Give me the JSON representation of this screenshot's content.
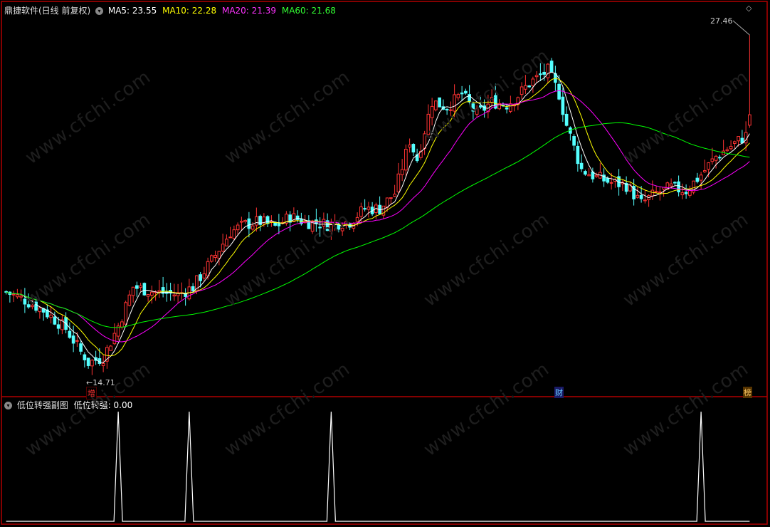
{
  "header": {
    "title": "鼎捷软件(日线 前复权)",
    "ma5_label": "MA5: 23.55",
    "ma10_label": "MA10: 22.28",
    "ma20_label": "MA20: 21.39",
    "ma60_label": "MA60: 21.68"
  },
  "sub_header": {
    "title": "低位转强副图",
    "value_label": "低位转强: 0.00"
  },
  "markers": {
    "high_label": "27.46",
    "low_label": "14.71",
    "tag_zeng": "增",
    "tag_cai": "财",
    "tag_bang": "榜"
  },
  "watermark": "www.cfchi.com",
  "colors": {
    "up": "#ff3333",
    "down": "#54ffff",
    "ma5": "#ffffff",
    "ma10": "#ffff00",
    "ma20": "#ff00ff",
    "ma60": "#00ff00",
    "frame": "#c00000"
  },
  "chart_data": [
    {
      "type": "candlestick",
      "title": "鼎捷软件(日线 前复权)",
      "ylim": [
        14.0,
        28.2
      ],
      "annotations": [
        {
          "text": "27.46",
          "kind": "high"
        },
        {
          "text": "14.71",
          "kind": "low"
        }
      ],
      "series": [
        {
          "name": "MA5",
          "last": 23.55
        },
        {
          "name": "MA10",
          "last": 22.28
        },
        {
          "name": "MA20",
          "last": 21.39
        },
        {
          "name": "MA60",
          "last": 21.68
        }
      ],
      "ohlc": []
    },
    {
      "type": "line",
      "title": "低位转强副图",
      "series": [
        {
          "name": "低位转强",
          "last": 0.0,
          "signal_bars": [
            30,
            49,
            87,
            186
          ]
        }
      ]
    }
  ]
}
